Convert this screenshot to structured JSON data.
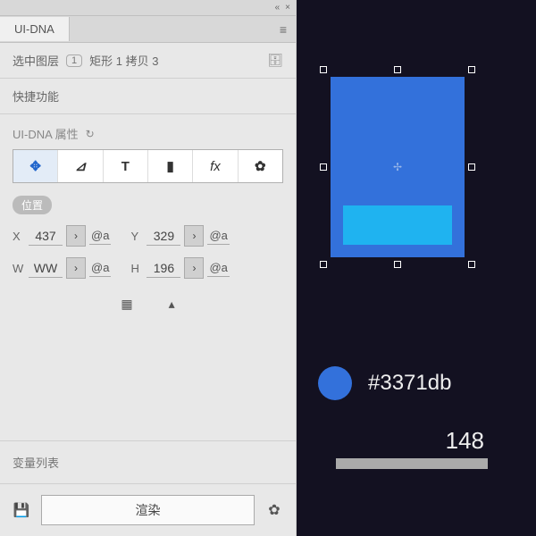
{
  "panel": {
    "tab": "UI-DNA",
    "selectedLayer": {
      "label": "选中图层",
      "count": "1",
      "name": "矩形 1 拷贝 3"
    },
    "quickFunc": "快捷功能",
    "propsTitle": "UI-DNA 属性",
    "posBadge": "位置",
    "coords": {
      "x": {
        "label": "X",
        "value": "437",
        "at": "@a"
      },
      "y": {
        "label": "Y",
        "value": "329",
        "at": "@a"
      },
      "w": {
        "label": "W",
        "value": "WW",
        "at": "@a"
      },
      "h": {
        "label": "H",
        "value": "196",
        "at": "@a"
      }
    },
    "varList": "变量列表",
    "renderBtn": "渲染"
  },
  "canvas": {
    "colorHex": "#3371db",
    "number": "148"
  }
}
